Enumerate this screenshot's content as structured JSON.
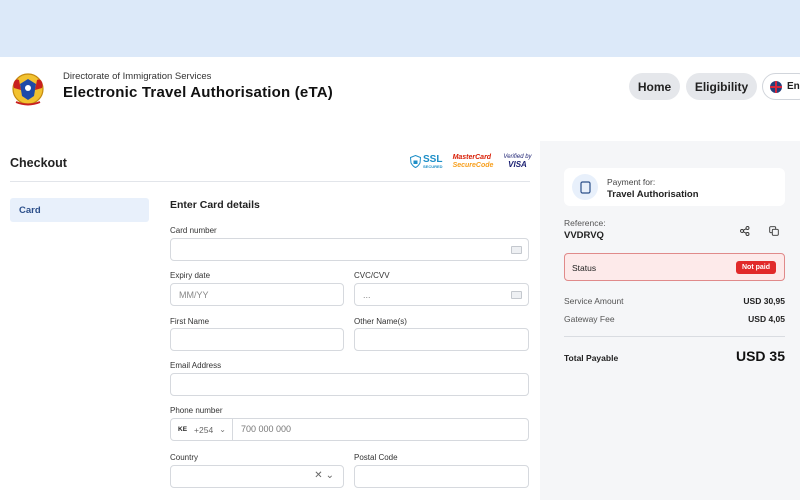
{
  "header": {
    "org_name": "Directorate of Immigration Services",
    "app_title": "Electronic Travel Authorisation (eTA)",
    "nav": {
      "home": "Home",
      "eligibility": "Eligibility"
    },
    "language": "Eng"
  },
  "checkout": {
    "title": "Checkout",
    "badges": {
      "ssl": "SSL",
      "ssl_sub": "SECURED",
      "mastercard_top": "MasterCard",
      "mastercard_bottom": "SecureCode",
      "visa_top": "Verified by",
      "visa_bottom": "VISA"
    },
    "side_tabs": [
      {
        "label": "Card"
      }
    ]
  },
  "form": {
    "title": "Enter Card details",
    "card_number": {
      "label": "Card number",
      "value": "",
      "placeholder": ""
    },
    "expiry": {
      "label": "Expiry date",
      "placeholder": "MM/YY"
    },
    "cvc": {
      "label": "CVC/CVV",
      "placeholder": "..."
    },
    "first_name": {
      "label": "First Name",
      "value": ""
    },
    "other_names": {
      "label": "Other Name(s)",
      "value": ""
    },
    "email": {
      "label": "Email Address",
      "value": ""
    },
    "phone": {
      "label": "Phone number",
      "country_code": "KE",
      "dial_code": "+254",
      "placeholder": "700 000 000"
    },
    "country": {
      "label": "Country",
      "value": ""
    },
    "postal_code": {
      "label": "Postal Code",
      "value": ""
    }
  },
  "summary": {
    "payment_for_label": "Payment for:",
    "payment_for_value": "Travel Authorisation",
    "reference_label": "Reference:",
    "reference_value": "VVDRVQ",
    "status_label": "Status",
    "status_badge": "Not paid",
    "service_amount_label": "Service Amount",
    "service_amount_value": "USD 30,95",
    "gateway_fee_label": "Gateway Fee",
    "gateway_fee_value": "USD 4,05",
    "total_label": "Total Payable",
    "total_value": "USD 35"
  },
  "colors": {
    "accent": "#2c4f8a",
    "status_red": "#e12a2a",
    "top_band": "#dce9f9"
  }
}
